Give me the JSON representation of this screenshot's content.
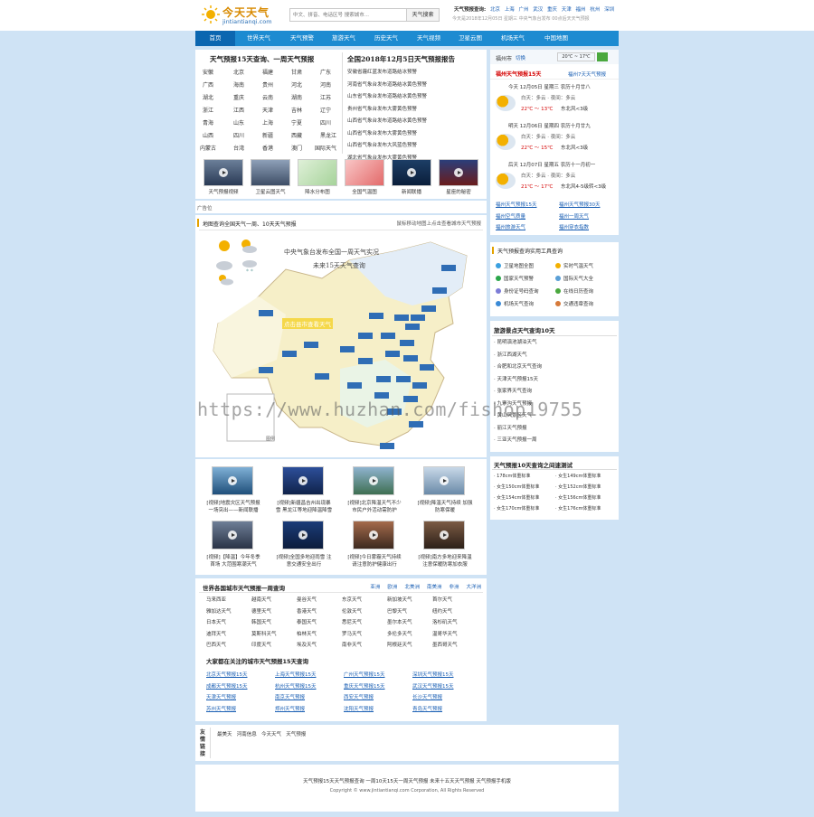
{
  "header": {
    "logo_name": "今天天气",
    "logo_url": "jintiantianqi.com",
    "search_placeholder": "中文、拼音、电话区号 搜索城市...",
    "search_button": "天气搜索",
    "hot_label": "天气预报查询:",
    "hot_cities": [
      "北京",
      "上海",
      "广州",
      "武汉",
      "重庆",
      "天津",
      "福州",
      "杭州",
      "深圳"
    ],
    "hot_note": "今天是2018年12月05日 星期三 中央气象台发布 00点后天天气预报"
  },
  "nav": [
    "首页",
    "世界天气",
    "天气预警",
    "旅游天气",
    "历史天气",
    "天气视频",
    "卫星云图",
    "机场天气",
    "中国地图"
  ],
  "left_top": {
    "title": "天气预报15天查询、一周天气预报",
    "provinces": [
      [
        "安徽",
        "北京",
        "福建",
        "甘肃",
        "广东"
      ],
      [
        "广西",
        "海南",
        "贵州",
        "河北",
        "河南"
      ],
      [
        "湖北",
        "重庆",
        "云南",
        "湖南",
        "江苏"
      ],
      [
        "浙江",
        "江西",
        "天津",
        "吉林",
        "辽宁"
      ],
      [
        "青海",
        "山东",
        "上海",
        "宁夏",
        "四川"
      ],
      [
        "山西",
        "四川",
        "新疆",
        "西藏",
        "黑龙江"
      ],
      [
        "内蒙古",
        "台湾",
        "香港",
        "澳门",
        "国际天气"
      ]
    ]
  },
  "report": {
    "title": "全国2018年12月5日天气预报报告",
    "items": [
      "安徽省霾红蓝发布道路结冰预警",
      "河南省气象台发布道路结冰黄色预警",
      "山东省气象台发布道路结冰黄色预警",
      "贵州省气象台发布大雾黄色预警",
      "山西省气象台发布道路结冰黄色预警",
      "山西省气象台发布大雾黄色预警",
      "山西省气象台发布大风蓝色预警",
      "湖北省气象台发布大雾黄色预警"
    ]
  },
  "videos_top": [
    {
      "label": "天气预报视频"
    },
    {
      "label": "卫星云图天气"
    },
    {
      "label": "降水分布图"
    },
    {
      "label": "全国气温图"
    },
    {
      "label": "新闻联播"
    },
    {
      "label": "星座的秘密"
    }
  ],
  "ad_label": "广告位",
  "map_section": {
    "title": "地图查询全国天气一周、10天天气预报",
    "hint": "鼠标移动地图上点击查看城市天气预报",
    "poster_line1": "中央气象台发布全国一周天气实况",
    "poster_line2": "未来15天天气查询",
    "highlight": "点击县市查看天气",
    "legend_label": "图例"
  },
  "videos_mid": [
    {
      "label": "[视频]地震灾区天气预报 一场突出——新闻联播"
    },
    {
      "label": "[视频]新疆昌吉州出现暴雪 黑龙江等地迎降温降雪"
    },
    {
      "label": "[视频]北京降温天气不少 市民户外活动需防护"
    },
    {
      "label": "[视频]降温天气持续 加强防寒保暖"
    },
    {
      "label": "[视频]【降温】今年冬季首场 大范围寒潮天气"
    },
    {
      "label": "[视频]全国多地迎雨雪 注意交通安全出行"
    },
    {
      "label": "[视频]今日雾霾天气持续 请注意防护健康出行"
    },
    {
      "label": "[视频]南方多地迎来降温 注意保暖防寒加衣服"
    }
  ],
  "world": {
    "title": "世界各国城市天气预报一周查询",
    "tabs": [
      "亚洲",
      "欧洲",
      "北美洲",
      "南美洲",
      "非洲",
      "大洋洲"
    ],
    "cities": [
      [
        "马来西亚",
        "越南天气",
        "曼谷天气",
        "东京天气",
        "新加坡天气",
        "首尔天气"
      ],
      [
        "雅加达天气",
        "德里天气",
        "香港天气",
        "伦敦天气",
        "巴黎天气",
        "纽约天气"
      ],
      [
        "日本天气",
        "韩国天气",
        "泰国天气",
        "悉尼天气",
        "墨尔本天气",
        "洛杉矶天气"
      ],
      [
        "迪拜天气",
        "莫斯科天气",
        "柏林天气",
        "罗马天气",
        "多伦多天气",
        "温哥华天气"
      ],
      [
        "巴西天气",
        "印度天气",
        "埃及天气",
        "南非天气",
        "阿根廷天气",
        "墨西哥天气"
      ]
    ],
    "focus_title": "大家都在关注的城市天气预报15天查询",
    "focus": [
      [
        "北京天气预报15天",
        "上海天气预报15天",
        "广州天气预报15天",
        "深圳天气预报15天"
      ],
      [
        "成都天气预报15天",
        "杭州天气预报15天",
        "重庆天气预报15天",
        "武汉天气预报15天"
      ],
      [
        "天津天气预报",
        "南京天气预报",
        "西安天气预报",
        "长沙天气预报"
      ],
      [
        "苏州天气预报",
        "郑州天气预报",
        "沈阳天气预报",
        "青岛天气预报"
      ]
    ]
  },
  "friend": {
    "label": "友情链接",
    "links": [
      "最美天",
      "河南信息",
      "今天天气",
      "天气预报"
    ]
  },
  "footer": {
    "line1": "天气预报15天天气预报查询 一周10天15天一周天气预报 未来十五天天气预报 天气预报手机版",
    "line2": "Copyright © www.jintiantianqi.com Corporation, All Rights Reserved"
  },
  "side": {
    "city": "福州市",
    "change": "切换",
    "temp_range": "20℃ ~ 17℃",
    "forecast_title": "福州天气预报15天",
    "forecast_link": "福州7天天气预报",
    "days": [
      {
        "date": "今天 12月05日 星期三 农历十月廿八",
        "weather": "白天：多云 · 夜间：多云",
        "temp": "22℃ 〜 13℃",
        "wind": "东北风<3级"
      },
      {
        "date": "明天 12月06日 星期四 农历十月廿九",
        "weather": "白天：多云 · 夜间：多云",
        "temp": "22℃ 〜 15℃",
        "wind": "东北风<3级"
      },
      {
        "date": "后天 12月07日 星期五 农历十一月初一",
        "weather": "白天：多云 · 夜间：多云",
        "temp": "21℃ 〜 17℃",
        "wind": "东北风4-5级转<3级"
      }
    ],
    "links": [
      [
        "福州天气预报15天",
        "福州天气预报30天"
      ],
      [
        "福州空气质量",
        "福州一周天气"
      ],
      [
        "福州旅游天气",
        "福州穿衣指数"
      ]
    ],
    "tools_title": "天气预报查询实用工具查询",
    "tools": [
      [
        "卫星地图全图",
        "实时气温天气"
      ],
      [
        "国家天气预警",
        "国际天气大全"
      ],
      [
        "身份证号码查询",
        "在线日历查询"
      ],
      [
        "机场天气查询",
        "交通违章查询"
      ]
    ],
    "tour_title": "旅游景点天气查询10天",
    "tour": [
      "昆明滇池湖泊天气",
      "浙江西湖天气",
      "合肥和北京天气查询",
      "天津天气预报15天",
      "张家界天气查询",
      "九寨沟天气预报",
      "黄山风景区天气",
      "丽江天气预报",
      "三亚天气预报一周"
    ],
    "weight_title": "天气预报10天查询之间速测试",
    "weight": [
      [
        "178cm体重标准",
        "女生149cm体重标准"
      ],
      [
        "女生150cm体重标准",
        "女生152cm体重标准"
      ],
      [
        "女生154cm体重标准",
        "女生156cm体重标准"
      ],
      [
        "女生170cm体重标准",
        "女生176cm体重标准"
      ]
    ]
  },
  "watermark": "https://www.huzhan.com/fishop19755",
  "colors": {
    "nav": "#1d8bd1",
    "nav_active": "#0b66b0",
    "bg": "#cfe3f5",
    "accent_red": "#d40000",
    "link": "#1a5fb4",
    "map_label": "#2f6db5"
  }
}
